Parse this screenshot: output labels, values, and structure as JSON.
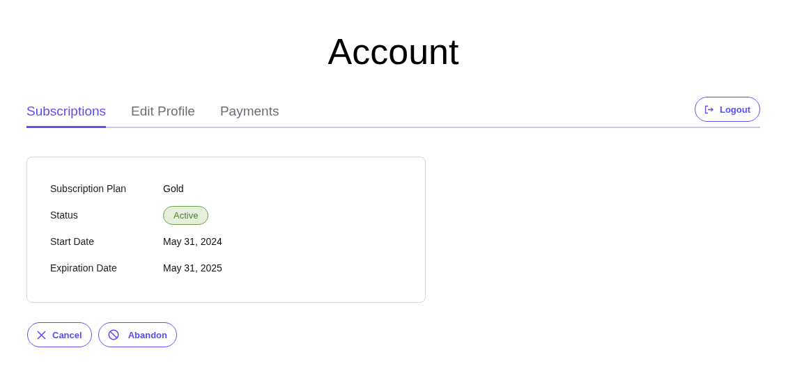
{
  "title": "Account",
  "tabs": [
    {
      "label": "Subscriptions",
      "selected": true
    },
    {
      "label": "Edit Profile",
      "selected": false
    },
    {
      "label": "Payments",
      "selected": false
    }
  ],
  "logout": {
    "label": "Logout"
  },
  "subscription": [
    {
      "label": "Subscription Plan",
      "kind": "text",
      "value": "Gold"
    },
    {
      "label": "Status",
      "kind": "badge",
      "value": "Active"
    },
    {
      "label": "Start Date",
      "kind": "text",
      "value": "May 31, 2024"
    },
    {
      "label": "Expiration Date",
      "kind": "text",
      "value": "May 31, 2025"
    }
  ],
  "actions": [
    {
      "label": "Cancel",
      "kind": "cancel"
    },
    {
      "label": "Abandon",
      "kind": "abandon"
    }
  ]
}
